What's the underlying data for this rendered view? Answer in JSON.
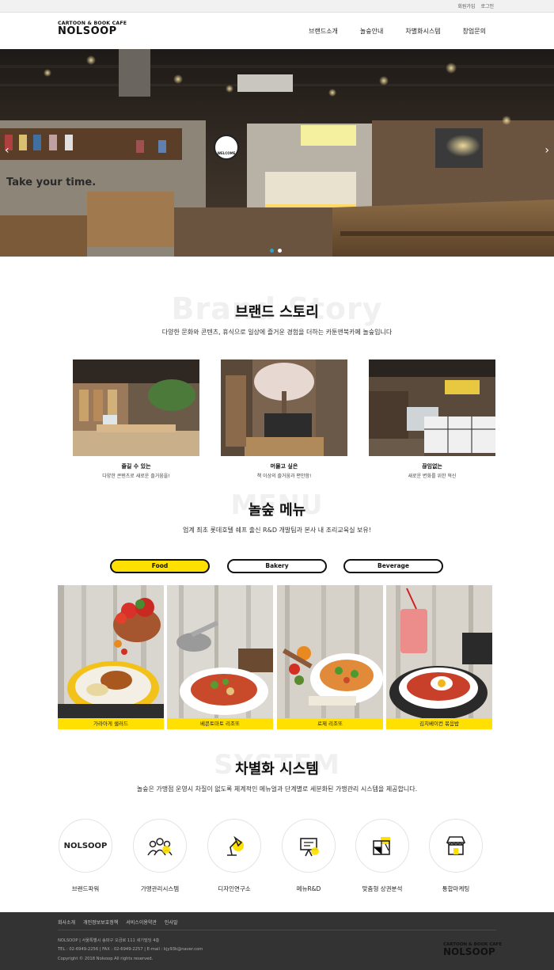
{
  "utility": {
    "signup": "회원가입",
    "login": "로그인"
  },
  "logo": {
    "sub": "CARTOON & BOOK CAFE",
    "main": "NOLSOOP"
  },
  "nav": [
    "브랜드소개",
    "놀숲안내",
    "차별화시스템",
    "창업문의"
  ],
  "hero": {
    "wall_text": "Take your time.",
    "sign_text": "WELCOME",
    "slides": 2,
    "active_slide": 0
  },
  "brand": {
    "bg_word": "Brand Story",
    "title": "브랜드 스토리",
    "desc": "다양한 문화와 콘텐츠, 휴식으로 일상에 즐거운 경험을 더하는 카툰앤북카페 놀숲입니다",
    "cards": [
      {
        "title": "즐길 수 있는",
        "desc": "다양한 콘텐츠로 새로운 즐거움을!"
      },
      {
        "title": "머물고 싶은",
        "desc": "책 이상의 즐거움과 편안함!"
      },
      {
        "title": "끊임없는",
        "desc": "새로운 변화를 위한 혁신"
      }
    ]
  },
  "menu": {
    "bg_word": "MENU",
    "title": "놀숲 메뉴",
    "desc": "업계 최초 롯데호텔 쉐프 출신 R&D 개발팀과 본사 내 조리교육실 보유!",
    "tabs": [
      "Food",
      "Bakery",
      "Beverage"
    ],
    "active_tab": "Food",
    "items": [
      "가라아게 샐러드",
      "베콘토마토 리조또",
      "로제 리조또",
      "김치베이컨 볶음밥"
    ]
  },
  "system": {
    "bg_word": "SYSTEM",
    "title": "차별화 시스템",
    "desc": "놀숲은 가맹점 운영시 차질이 없도록 체계적인 메뉴얼과 단계별로 세분화된 가맹관리 시스템을 제공합니다.",
    "logo_text": "NOLSOOP",
    "items": [
      "브랜드파워",
      "가맹관리시스템",
      "디자인연구소",
      "메뉴R&D",
      "맞춤형 상권분석",
      "통합마케팅"
    ]
  },
  "footer": {
    "links": [
      "회사소개",
      "개인정보보호정책",
      "서비스이용약관",
      "인사말"
    ],
    "address": "NOLSOOP | 서울특별시 송파구 오금로 111 세기빌딩 4층",
    "contact": "TEL : 02-6949-2256 | FAX : 02-6949-2257 | E-mail : kjy93k@naver.com",
    "copyright": "Copyright © 2018 Nolsoop All rights reserved."
  },
  "colors": {
    "accent": "#ffe000",
    "footer_bg": "#333333",
    "dot_active": "#2aa3d6"
  }
}
